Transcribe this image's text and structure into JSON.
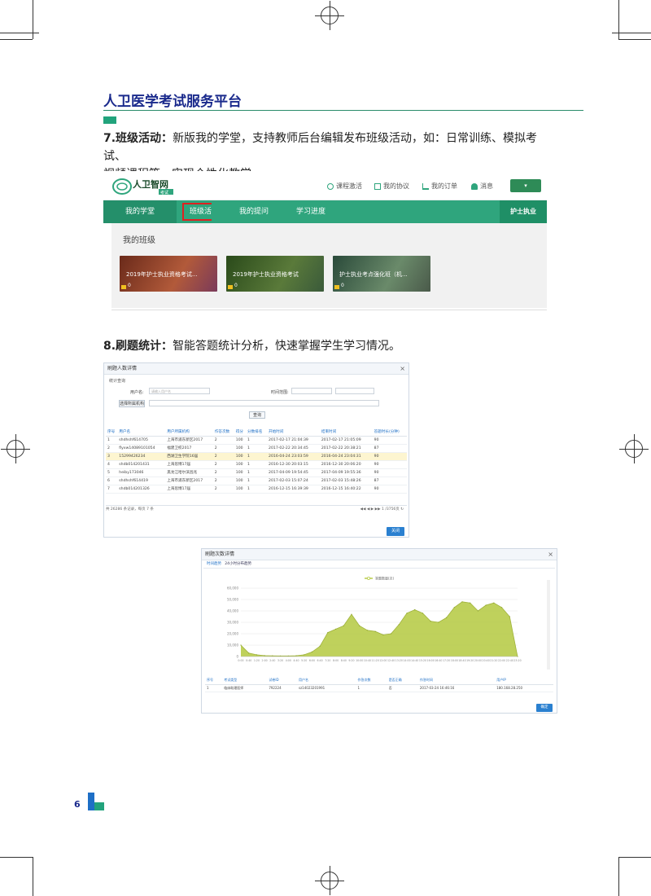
{
  "header": {
    "title": "人卫医学考试服务平台"
  },
  "section7": {
    "label": "7.班级活动：",
    "text_line1": "新版我的学堂，支持教师后台编辑发布班级活动，如：日常训练、模拟考试、",
    "text_line2": "视频课程等，实现个性化教学。"
  },
  "screen1": {
    "logo_text": "人卫智网",
    "logo_sub": "考试",
    "top_links": [
      "课程激活",
      "我的协议",
      "我的订单",
      "消息"
    ],
    "nav_tabs": [
      "我的学堂",
      "班级活动",
      "我的提问",
      "学习进度"
    ],
    "nav_right": "护士执业",
    "panel_title": "我的班级",
    "cards": [
      {
        "title": "2019年护士执业资格考试...",
        "count": "0",
        "color": "#8a3a2a"
      },
      {
        "title": "2019年护士执业资格考试",
        "count": "0",
        "color": "#3a5a2a"
      },
      {
        "title": "护士执业考点强化班（机...",
        "count": "0",
        "color": "#4a6a5a"
      }
    ]
  },
  "section8": {
    "label": "8.刷题统计：",
    "text": "智能答题统计分析，快速掌握学生学习情况。"
  },
  "screen2": {
    "dialog_title": "刷题人数详情",
    "filter_title": "统计查询",
    "user_label": "用户名:",
    "user_placeholder": "请输入用户名",
    "time_label": "时间范围:",
    "org_button": "选择所属机构",
    "query_button": "查询",
    "columns": [
      "序号",
      "用户名",
      "用户所属机构",
      "作答次数",
      "得分",
      "分数排名",
      "开始时间",
      "结束时间",
      "答题时长(分钟)"
    ],
    "rows": [
      [
        "1",
        "shdhshf614705",
        "上海市浦东新区2017",
        "2",
        "100",
        "1",
        "2017-02-17 21:04:39",
        "2017-02-17 21:05:09",
        "90"
      ],
      [
        "2",
        "flyxw14089101054",
        "福建卫校2017",
        "2",
        "100",
        "1",
        "2017-02-22 20:34:45",
        "2017-02-22 20:38:21",
        "87"
      ],
      [
        "3",
        "15299426234",
        "西湖卫生学院16届",
        "2",
        "100",
        "1",
        "2016-04-24 23:03:59",
        "2016-04-24 23:04:31",
        "90"
      ],
      [
        "4",
        "shdb014201431",
        "上海思博17届",
        "2",
        "100",
        "1",
        "2016-12-30 20:03:15",
        "2016-12-30 20:06:20",
        "90"
      ],
      [
        "5",
        "heiby173046",
        "黑龙江哈尔滨昌兆",
        "2",
        "100",
        "1",
        "2017-04-09 19:54:45",
        "2017-04-09 19:55:36",
        "90"
      ],
      [
        "6",
        "shdhshf614419",
        "上海市浦东新区2017",
        "2",
        "100",
        "1",
        "2017-02-03 15:07:24",
        "2017-02-03 15:48:26",
        "87"
      ],
      [
        "7",
        "shdb014201326",
        "上海思博17届",
        "2",
        "100",
        "1",
        "2016-12-15 16:39:39",
        "2016-12-15 16:40:22",
        "90"
      ]
    ],
    "pager_text": "共 26286 条记录，每页 7 条",
    "pager_page": "1 /3756页",
    "close_button": "关闭"
  },
  "screen3": {
    "dialog_title": "刷题次数详情",
    "tabs": [
      "时间趋势",
      "24小时分布趋势"
    ],
    "table_columns": [
      "序号",
      "考试类型",
      "试卷ID",
      "用户名",
      "作答次数",
      "是否正确",
      "作答时间",
      "用户IP"
    ],
    "table_rows": [
      [
        "1",
        "临床助理医师",
        "792224",
        "sz14023201991",
        "1",
        "否",
        "2017-03-24 16:46:16",
        "180.168.28.250"
      ]
    ],
    "ok_button": "确定"
  },
  "chart_data": {
    "type": "area",
    "title": "",
    "legend": [
      "答题数量(次)"
    ],
    "xlabel": "",
    "ylabel": "",
    "ylim": [
      0,
      60000
    ],
    "yticks": [
      "0",
      "10,000",
      "20,000",
      "30,000",
      "40,000",
      "50,000",
      "60,000"
    ],
    "x": [
      "0:00",
      "0:40",
      "1:20",
      "2:00",
      "2:40",
      "3:20",
      "4:00",
      "4:40",
      "5:20",
      "6:00",
      "6:40",
      "7:20",
      "8:00",
      "8:40",
      "9:20",
      "10:00",
      "10:40",
      "11:20",
      "12:00",
      "12:40",
      "13:20",
      "14:00",
      "14:40",
      "15:20",
      "16:00",
      "16:40",
      "17:20",
      "18:00",
      "18:40",
      "19:20",
      "20:00",
      "20:40",
      "21:20",
      "22:00",
      "22:40",
      "23:20"
    ],
    "series": [
      {
        "name": "答题数量(次)",
        "values": [
          10000,
          3000,
          1500,
          800,
          600,
          500,
          500,
          700,
          1500,
          4000,
          9000,
          21000,
          24000,
          27000,
          37000,
          27000,
          23000,
          22000,
          19000,
          20000,
          28000,
          38000,
          41000,
          38000,
          31000,
          30000,
          34000,
          43000,
          48000,
          47000,
          40000,
          45000,
          47000,
          43000,
          35000,
          0
        ],
        "color": "#b8cc4a"
      }
    ]
  },
  "footer": {
    "page_number": "6"
  }
}
